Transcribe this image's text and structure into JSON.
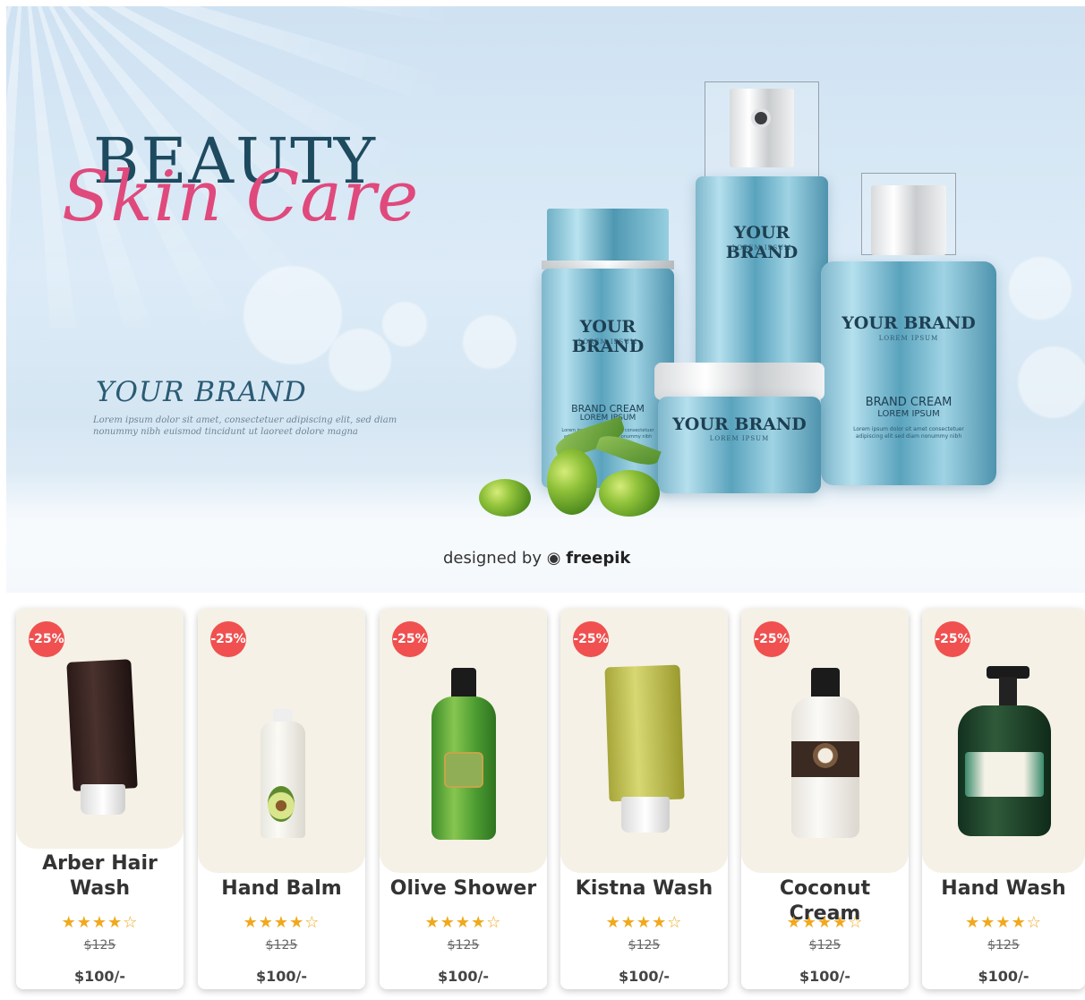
{
  "banner": {
    "headline_1": "BEAUTY",
    "headline_2": "Skin Care",
    "brand": "YOUR BRAND",
    "lorem": "Lorem ipsum dolor sit amet, consectetuer adipiscing elit, sed diam nonummy nibh euismod tincidunt ut laoreet dolore magna",
    "credit_prefix": "designed by",
    "credit_brand": "freepik",
    "bottles": {
      "brand": "YOUR BRAND",
      "lorem": "LOREM IPSUM",
      "cream": "BRAND CREAM",
      "cream_sub": "LOREM IPSUM",
      "tiny": "Lorem ipsum dolor sit amet consectetuer adipiscing elit sed diam nonummy nibh"
    }
  },
  "products": [
    {
      "discount": "-25%",
      "name": "Arber Hair Wash",
      "rating": "★★★★☆",
      "old_price": "$125",
      "price": "$100/-"
    },
    {
      "discount": "-25%",
      "name": "Hand Balm",
      "rating": "★★★★☆",
      "old_price": "$125",
      "price": "$100/-"
    },
    {
      "discount": "-25%",
      "name": "Olive Shower",
      "rating": "★★★★☆",
      "old_price": "$125",
      "price": "$100/-"
    },
    {
      "discount": "-25%",
      "name": "Kistna Wash",
      "rating": "★★★★☆",
      "old_price": "$125",
      "price": "$100/-"
    },
    {
      "discount": "-25%",
      "name": "Coconut Cream",
      "rating": "★★★★☆",
      "old_price": "$125",
      "price": "$100/-"
    },
    {
      "discount": "-25%",
      "name": "Hand Wash",
      "rating": "★★★★☆",
      "old_price": "$125",
      "price": "$100/-"
    }
  ],
  "colors": {
    "badge": "#f0504f",
    "stars": "#f0a91d",
    "card_image_bg": "#f5f1e6",
    "headline_pink": "#e0497c",
    "headline_navy": "#1d4a5e"
  }
}
